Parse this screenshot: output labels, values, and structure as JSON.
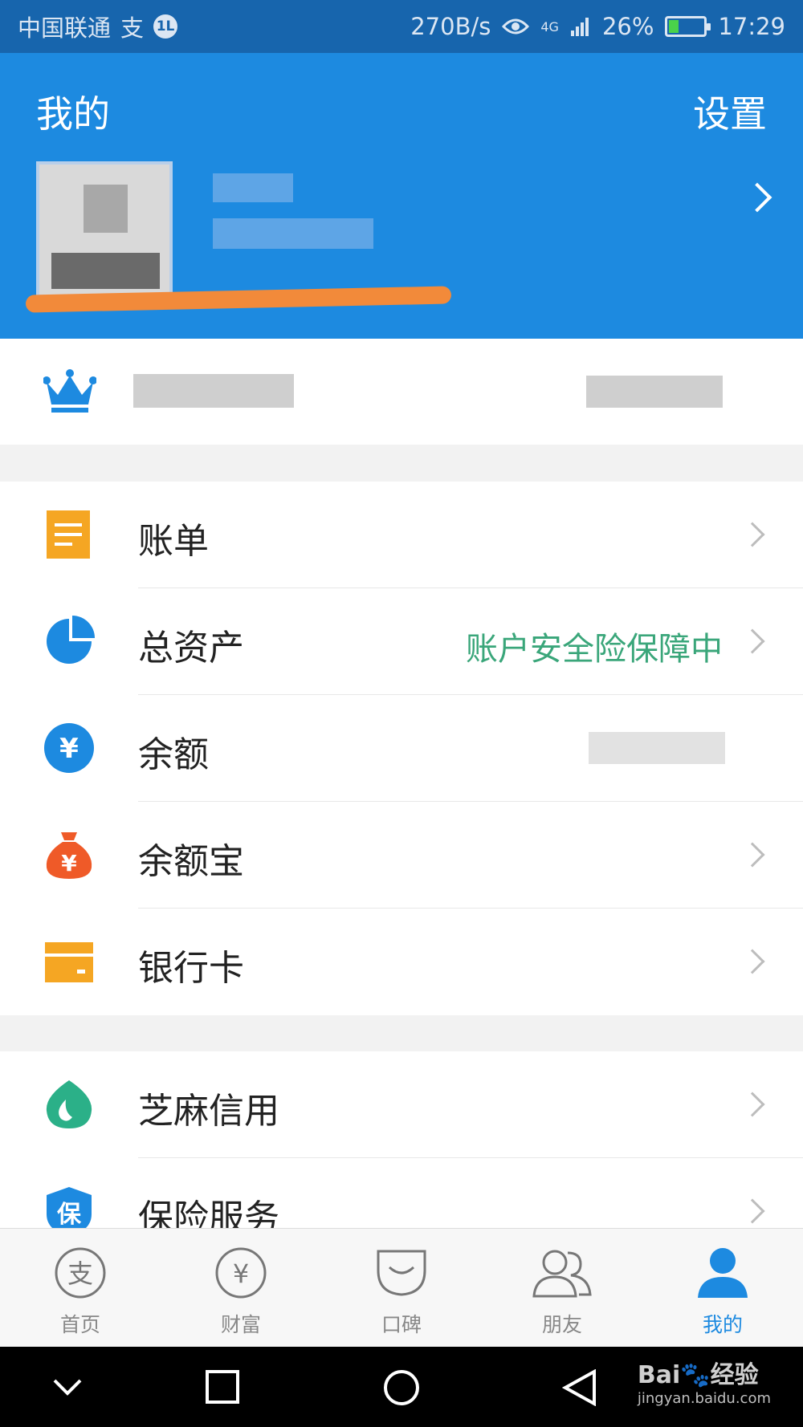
{
  "status_bar": {
    "carrier": "中国联通",
    "alipay_glyph": "支",
    "badge": "1L",
    "speed": "270B/s",
    "network": "4G",
    "battery": "26%",
    "battery_level": 0.26,
    "time": "17:29"
  },
  "header": {
    "title": "我的",
    "settings": "设置"
  },
  "menu": {
    "section1": [
      {
        "label": "账单",
        "value": "",
        "icon": "bill-icon",
        "color": "#f5a623"
      },
      {
        "label": "总资产",
        "value": "账户安全险保障中",
        "icon": "pie-chart-icon",
        "color": "#1d8ae0"
      },
      {
        "label": "余额",
        "value": "",
        "icon": "yuan-coin-icon",
        "color": "#1d8ae0"
      },
      {
        "label": "余额宝",
        "value": "",
        "icon": "money-bag-icon",
        "color": "#ef5a28"
      },
      {
        "label": "银行卡",
        "value": "",
        "icon": "bank-card-icon",
        "color": "#f5a623"
      }
    ],
    "section2": [
      {
        "label": "芝麻信用",
        "value": "",
        "icon": "sesame-credit-icon",
        "color": "#2bb088"
      },
      {
        "label": "保险服务",
        "value": "",
        "icon": "insurance-shield-icon",
        "color": "#1d8ae0"
      }
    ]
  },
  "tabs": [
    {
      "label": "首页",
      "icon": "alipay-home-icon",
      "active": false
    },
    {
      "label": "财富",
      "icon": "yuan-circle-icon",
      "active": false
    },
    {
      "label": "口碑",
      "icon": "koubei-icon",
      "active": false
    },
    {
      "label": "朋友",
      "icon": "friends-icon",
      "active": false
    },
    {
      "label": "我的",
      "icon": "person-icon",
      "active": true
    }
  ],
  "colors": {
    "brand_blue": "#1d8ae0",
    "status_bar": "#1765ad",
    "accent_green": "#3aa67a"
  },
  "watermark": {
    "brand": "Bai🐾经验",
    "url": "jingyan.baidu.com"
  }
}
